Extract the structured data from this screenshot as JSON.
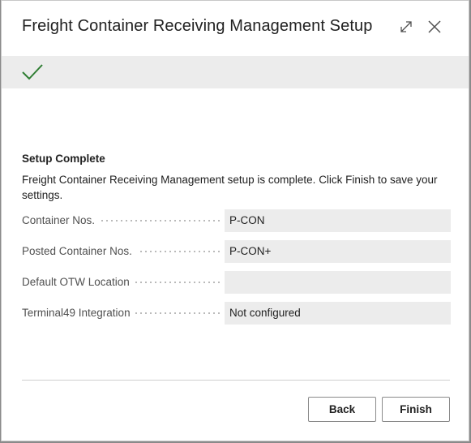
{
  "dialog": {
    "title": "Freight Container Receiving Management Setup",
    "expand_icon": "expand-icon",
    "close_icon": "close-icon"
  },
  "banner": {
    "icon": "checkmark-icon",
    "icon_color": "#2e7d32",
    "background": "#ececec"
  },
  "content": {
    "section_title": "Setup Complete",
    "description": "Freight Container Receiving Management setup is complete. Click Finish to save your settings."
  },
  "fields": [
    {
      "label": "Container Nos.",
      "value": "P-CON"
    },
    {
      "label": "Posted Container Nos.",
      "value": "P-CON+"
    },
    {
      "label": "Default OTW Location",
      "value": ""
    },
    {
      "label": "Terminal49 Integration",
      "value": "Not configured"
    }
  ],
  "buttons": {
    "back": "Back",
    "finish": "Finish"
  }
}
